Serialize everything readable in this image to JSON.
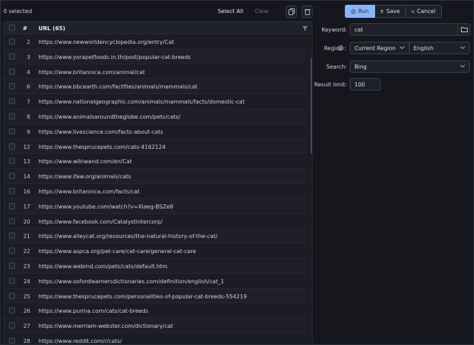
{
  "toolbar": {
    "selected": "0 selected",
    "select_all": "Select All",
    "clear": "Clear"
  },
  "actions": {
    "run": "Run",
    "save": "Save",
    "cancel": "Cancel"
  },
  "table": {
    "col_num": "#",
    "col_url": "URL (65)",
    "rows": [
      {
        "n": "2",
        "url": "https://www.newworldencyclopedia.org/entry/Cat"
      },
      {
        "n": "3",
        "url": "https://www.yorapetfoods.in.th/post/popular-cat-breeds"
      },
      {
        "n": "4",
        "url": "https://www.britannica.com/animal/cat"
      },
      {
        "n": "6",
        "url": "https://www.bbcearth.com/factfiles/animals/mammals/cat"
      },
      {
        "n": "7",
        "url": "https://www.nationalgeographic.com/animals/mammals/facts/domestic-cat"
      },
      {
        "n": "8",
        "url": "https://www.animalsaroundtheglobe.com/pets/cats/"
      },
      {
        "n": "9",
        "url": "https://www.livescience.com/facts-about-cats"
      },
      {
        "n": "12",
        "url": "https://www.thesprucepets.com/cats-4162124"
      },
      {
        "n": "13",
        "url": "https://www.wikiwand.com/en/Cat"
      },
      {
        "n": "14",
        "url": "https://www.ifaw.org/animals/cats"
      },
      {
        "n": "16",
        "url": "https://www.britannica.com/facts/cat"
      },
      {
        "n": "17",
        "url": "https://www.youtube.com/watch?v=Xiaeg-BSZe8"
      },
      {
        "n": "20",
        "url": "https://www.facebook.com/Catalystintercorp/"
      },
      {
        "n": "21",
        "url": "https://www.alleycat.org/resources/the-natural-history-of-the-cat/"
      },
      {
        "n": "22",
        "url": "https://www.aspca.org/pet-care/cat-care/general-cat-care"
      },
      {
        "n": "23",
        "url": "https://www.webmd.com/pets/cats/default.htm"
      },
      {
        "n": "24",
        "url": "https://www.oxfordlearnersdictionaries.com/definition/english/cat_1"
      },
      {
        "n": "25",
        "url": "https://www.thesprucepets.com/personalities-of-popular-cat-breeds-554219"
      },
      {
        "n": "26",
        "url": "https://www.purina.com/cats/cat-breeds"
      },
      {
        "n": "27",
        "url": "https://www.merriam-webster.com/dictionary/cat"
      },
      {
        "n": "28",
        "url": "https://www.reddit.com/r/cats/"
      }
    ]
  },
  "form": {
    "keyword_label": "Keyword:",
    "keyword_value": "cat",
    "region_label": "Region",
    "region_value": "Current Region",
    "language_value": "English",
    "search_label": "Search:",
    "search_value": "Bing",
    "limit_label": "Result limit:",
    "limit_value": "100"
  },
  "colors": {
    "accent": "#8ab4f8",
    "background": "#16171d"
  }
}
